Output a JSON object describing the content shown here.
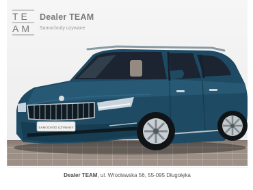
{
  "logo": {
    "letters_top": "TE",
    "letters_bottom": "AM"
  },
  "brand": {
    "name": "Dealer TEAM",
    "tagline": "Samochody używane"
  },
  "car": {
    "plate_text": "SAMOCHÓD UŻYWANY",
    "color": "#1e4a63"
  },
  "footer": {
    "dealer": "Dealer TEAM",
    "address": ", ul. Wrocławska 56, 55-095 Długołęka"
  }
}
